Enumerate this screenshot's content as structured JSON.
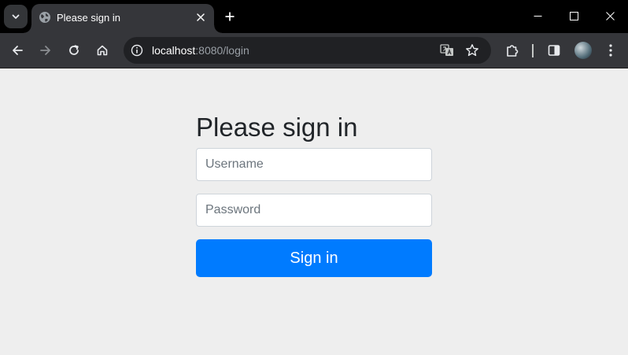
{
  "browser": {
    "tab": {
      "title": "Please sign in",
      "favicon": "globe-icon"
    },
    "address_bar": {
      "host": "localhost",
      "rest": ":8080/login"
    },
    "icons": {
      "tab_search": "chevron-down-icon",
      "tab_close": "close-icon",
      "new_tab": "plus-icon",
      "minimize": "minimize-icon",
      "maximize": "maximize-icon",
      "close_window": "close-icon",
      "back": "arrow-left-icon",
      "forward": "arrow-right-icon",
      "reload": "reload-icon",
      "home": "home-icon",
      "site_info": "info-icon",
      "translate": "translate-icon",
      "bookmark": "star-icon",
      "extensions": "puzzle-icon",
      "side_panel": "side-panel-icon",
      "profile": "avatar",
      "menu": "kebab-menu-icon"
    },
    "colors": {
      "frame": "#000000",
      "toolbar": "#35363a",
      "omnibox": "#202124"
    }
  },
  "login": {
    "heading": "Please sign in",
    "username_placeholder": "Username",
    "username_value": "",
    "password_placeholder": "Password",
    "password_value": "",
    "submit_label": "Sign in",
    "colors": {
      "background": "#eeeeee",
      "primary": "#007bff",
      "text": "#212529"
    }
  }
}
